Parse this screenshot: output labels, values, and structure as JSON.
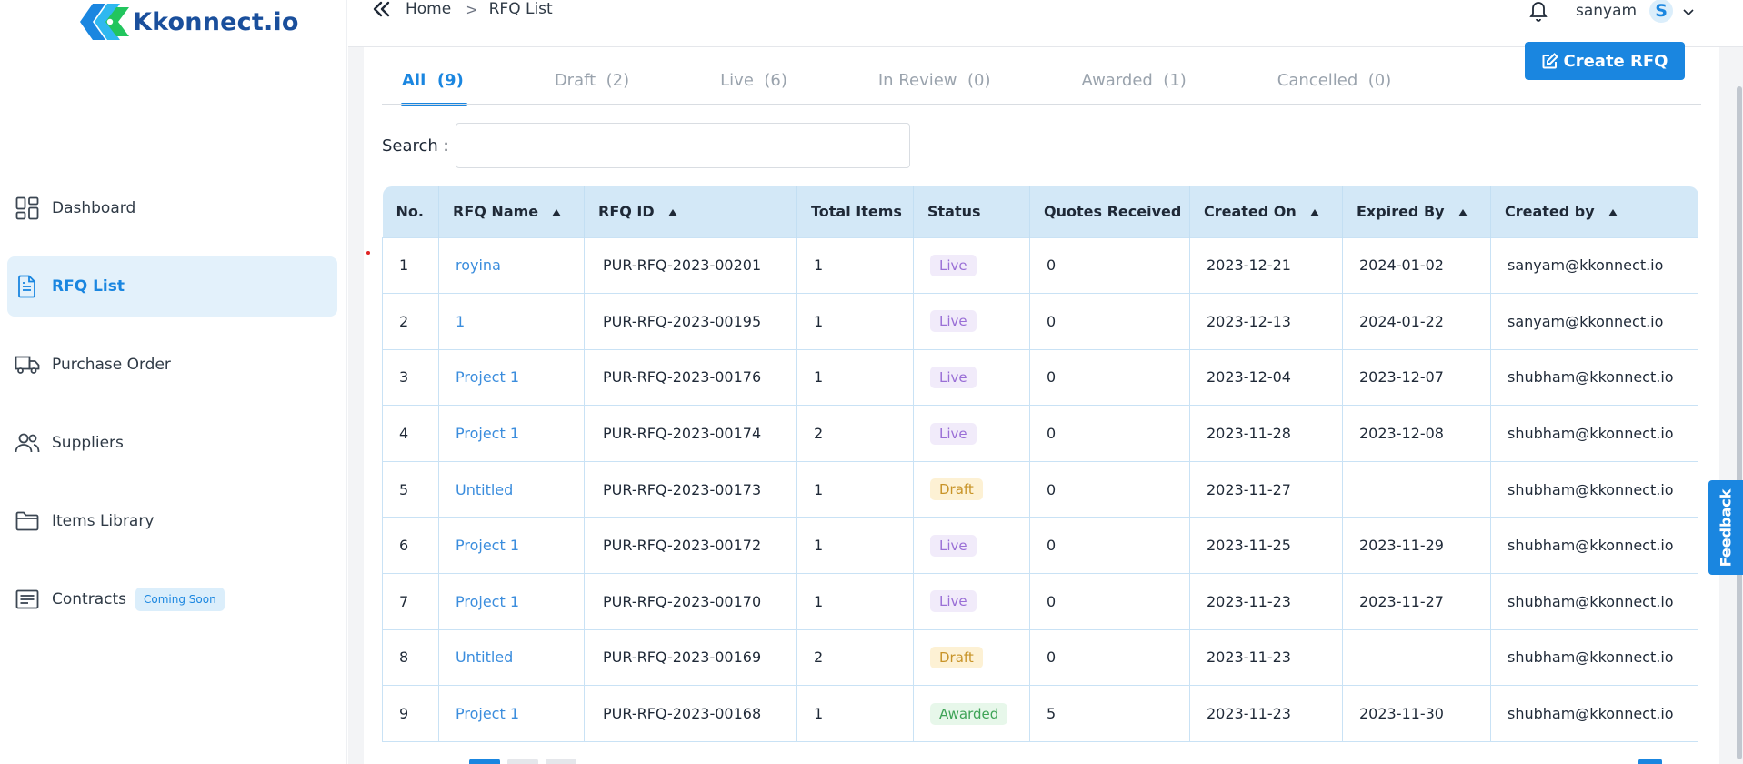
{
  "brand": {
    "name": "Kkonnect.io"
  },
  "breadcrumb": {
    "home": "Home",
    "separator": ">",
    "current": "RFQ List"
  },
  "user": {
    "name": "sanyam",
    "initial": "S"
  },
  "sidebar": {
    "items": [
      {
        "label": "Dashboard",
        "icon": "dashboard-icon"
      },
      {
        "label": "RFQ List",
        "icon": "document-icon",
        "active": true
      },
      {
        "label": "Purchase Order",
        "icon": "truck-icon"
      },
      {
        "label": "Suppliers",
        "icon": "users-icon"
      },
      {
        "label": "Items Library",
        "icon": "folder-icon"
      },
      {
        "label": "Contracts",
        "icon": "contract-icon",
        "badge": "Coming Soon"
      }
    ]
  },
  "toolbar": {
    "create_label": "Create RFQ"
  },
  "tabs": [
    {
      "label": "All",
      "count": "(9)",
      "active": true
    },
    {
      "label": "Draft",
      "count": "(2)"
    },
    {
      "label": "Live",
      "count": "(6)"
    },
    {
      "label": "In Review",
      "count": "(0)"
    },
    {
      "label": "Awarded",
      "count": "(1)"
    },
    {
      "label": "Cancelled",
      "count": "(0)"
    }
  ],
  "search": {
    "label": "Search :",
    "value": "",
    "placeholder": ""
  },
  "table": {
    "columns": [
      "No.",
      "RFQ Name",
      "RFQ ID",
      "Total Items",
      "Status",
      "Quotes Received",
      "Created On",
      "Expired By",
      "Created by"
    ],
    "rows": [
      {
        "no": "1",
        "name": "royina",
        "id": "PUR-RFQ-2023-00201",
        "items": "1",
        "status": "Live",
        "quotes": "0",
        "created": "2023-12-21",
        "expires": "2024-01-02",
        "by": "sanyam@kkonnect.io"
      },
      {
        "no": "2",
        "name": "1",
        "id": "PUR-RFQ-2023-00195",
        "items": "1",
        "status": "Live",
        "quotes": "0",
        "created": "2023-12-13",
        "expires": "2024-01-22",
        "by": "sanyam@kkonnect.io"
      },
      {
        "no": "3",
        "name": "Project 1",
        "id": "PUR-RFQ-2023-00176",
        "items": "1",
        "status": "Live",
        "quotes": "0",
        "created": "2023-12-04",
        "expires": "2023-12-07",
        "by": "shubham@kkonnect.io"
      },
      {
        "no": "4",
        "name": "Project 1",
        "id": "PUR-RFQ-2023-00174",
        "items": "2",
        "status": "Live",
        "quotes": "0",
        "created": "2023-11-28",
        "expires": "2023-12-08",
        "by": "shubham@kkonnect.io"
      },
      {
        "no": "5",
        "name": "Untitled",
        "id": "PUR-RFQ-2023-00173",
        "items": "1",
        "status": "Draft",
        "quotes": "0",
        "created": "2023-11-27",
        "expires": "",
        "by": "shubham@kkonnect.io"
      },
      {
        "no": "6",
        "name": "Project 1",
        "id": "PUR-RFQ-2023-00172",
        "items": "1",
        "status": "Live",
        "quotes": "0",
        "created": "2023-11-25",
        "expires": "2023-11-29",
        "by": "shubham@kkonnect.io"
      },
      {
        "no": "7",
        "name": "Project 1",
        "id": "PUR-RFQ-2023-00170",
        "items": "1",
        "status": "Live",
        "quotes": "0",
        "created": "2023-11-23",
        "expires": "2023-11-27",
        "by": "shubham@kkonnect.io"
      },
      {
        "no": "8",
        "name": "Untitled",
        "id": "PUR-RFQ-2023-00169",
        "items": "2",
        "status": "Draft",
        "quotes": "0",
        "created": "2023-11-23",
        "expires": "",
        "by": "shubham@kkonnect.io"
      },
      {
        "no": "9",
        "name": "Project 1",
        "id": "PUR-RFQ-2023-00168",
        "items": "1",
        "status": "Awarded",
        "quotes": "5",
        "created": "2023-11-23",
        "expires": "2023-11-30",
        "by": "shubham@kkonnect.io"
      }
    ]
  },
  "feedback": {
    "label": "Feedback"
  },
  "colors": {
    "accent": "#1a86e0",
    "brand_dark": "#1a4f9c",
    "brand_green": "#22c55e",
    "live": "#9a6fd6",
    "draft": "#c89327",
    "awarded": "#3ea356"
  }
}
